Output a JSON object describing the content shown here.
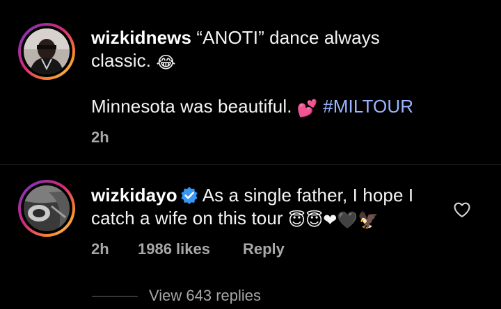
{
  "comments": [
    {
      "username": "wizkidnews",
      "text_line1": "“ANOTI” dance always",
      "text_line2": "classic.",
      "emoji_line2": "😂",
      "text_line3": "Minnesota was beautiful.",
      "emoji_line3": "💕",
      "hashtag": "#MILTOUR",
      "time": "2h"
    },
    {
      "username": "wizkidayo",
      "verified": true,
      "text_line1": "As a single father, I hope I",
      "text_line2": "catch a wife on this tour",
      "emoji_line2": "😇😇❤🖤🦅",
      "time": "2h",
      "likes": "1986 likes",
      "reply_label": "Reply",
      "view_replies": "View 643 replies"
    }
  ],
  "colors": {
    "background": "#000000",
    "text": "#f5f5f5",
    "muted": "#a8a8a8",
    "hashtag": "#9ab6ff",
    "verified": "#3897f0"
  },
  "icons": [
    "verified-badge-icon",
    "heart-outline-icon"
  ]
}
